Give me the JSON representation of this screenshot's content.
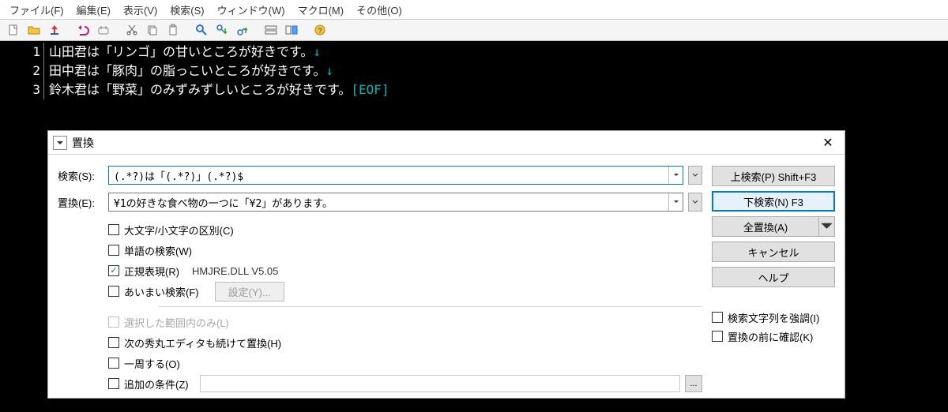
{
  "menu": {
    "file": "ファイル(F)",
    "edit": "編集(E)",
    "view": "表示(V)",
    "search": "検索(S)",
    "window": "ウィンドウ(W)",
    "macro": "マクロ(M)",
    "other": "その他(O)"
  },
  "editor": {
    "lines": [
      {
        "n": "1",
        "text": "山田君は「リンゴ」の甘いところが好きです。",
        "eol": "↓"
      },
      {
        "n": "2",
        "text": "田中君は「豚肉」の脂っこいところが好きです。",
        "eol": "↓"
      },
      {
        "n": "3",
        "text": "鈴木君は「野菜」のみずみずしいところが好きです。",
        "eof": "[EOF]"
      }
    ]
  },
  "dialog": {
    "title": "置換",
    "search_label": "検索(S):",
    "replace_label": "置換(E):",
    "search_value": "(.*?)は「(.*?)」(.*?)$",
    "replace_value": "¥1の好きな食べ物の一つに「¥2」があります。",
    "checks": {
      "case": "大文字/小文字の区別(C)",
      "word": "単語の検索(W)",
      "regex": "正規表現(R)",
      "regex_dll": "HMJRE.DLL V5.05",
      "fuzzy": "あいまい検索(F)",
      "fuzzy_btn": "設定(Y)...",
      "sel_only": "選択した範囲内のみ(L)",
      "next_hidemaru": "次の秀丸エディタも続けて置換(H)",
      "wrap": "一周する(O)",
      "extra_cond": "追加の条件(Z)"
    },
    "buttons": {
      "find_up": "上検索(P) Shift+F3",
      "find_down": "下検索(N) F3",
      "replace_all": "全置換(A)",
      "cancel": "キャンセル",
      "help": "ヘルプ"
    },
    "right_checks": {
      "highlight": "検索文字列を強調(I)",
      "confirm": "置換の前に確認(K)"
    }
  }
}
